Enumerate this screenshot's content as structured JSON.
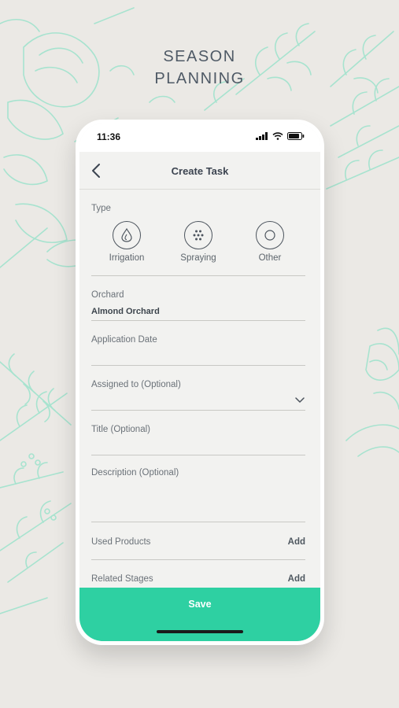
{
  "headline": {
    "line1": "SEASON",
    "line2": "PLANNING"
  },
  "colors": {
    "accent": "#2ed0a2",
    "decor": "#a7e3cf",
    "background": "#ebe9e5"
  },
  "status_bar": {
    "time": "11:36",
    "icons": [
      "cellular-signal-icon",
      "wifi-icon",
      "battery-icon"
    ]
  },
  "nav": {
    "title": "Create Task",
    "back_icon": "chevron-left-icon"
  },
  "form": {
    "type": {
      "label": "Type",
      "options": [
        {
          "label": "Irrigation",
          "icon": "water-drop-icon"
        },
        {
          "label": "Spraying",
          "icon": "spray-dots-icon"
        },
        {
          "label": "Other",
          "icon": "circle-icon"
        }
      ]
    },
    "orchard": {
      "label": "Orchard",
      "value": "Almond Orchard"
    },
    "application_date": {
      "label": "Application Date",
      "value": ""
    },
    "assigned_to": {
      "label": "Assigned to (Optional)",
      "value": ""
    },
    "title": {
      "label": "Title (Optional)",
      "value": ""
    },
    "description": {
      "label": "Description (Optional)",
      "value": ""
    },
    "used_products": {
      "label": "Used Products",
      "action": "Add"
    },
    "related_stages": {
      "label": "Related Stages",
      "action": "Add"
    }
  },
  "save": {
    "label": "Save"
  }
}
